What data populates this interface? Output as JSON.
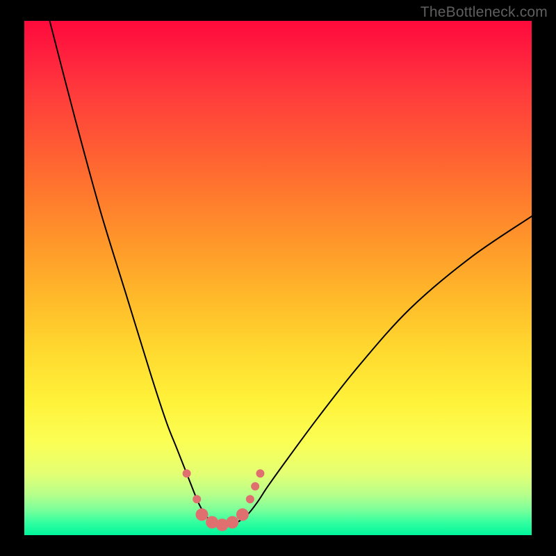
{
  "watermark": "TheBottleneck.com",
  "chart_data": {
    "type": "line",
    "title": "",
    "xlabel": "",
    "ylabel": "",
    "xlim": [
      0,
      100
    ],
    "ylim": [
      0,
      100
    ],
    "grid": false,
    "series": [
      {
        "name": "bottleneck-curve",
        "x": [
          5,
          10,
          15,
          20,
          25,
          28,
          30,
          32,
          34,
          35,
          36,
          37,
          38,
          39,
          40,
          41,
          42,
          44,
          46,
          48,
          52,
          58,
          66,
          76,
          88,
          100
        ],
        "values": [
          100,
          81,
          63,
          47,
          31,
          22,
          17,
          12,
          7,
          5,
          3.5,
          2.5,
          2,
          2,
          2,
          2,
          2.5,
          4,
          6.5,
          9.5,
          15,
          23,
          33,
          44,
          54,
          62
        ],
        "color": "#000000",
        "stroke_width": 2
      }
    ],
    "markers": {
      "name": "highlight-dots",
      "color": "#e07070",
      "radius_small": 6,
      "radius_large": 9,
      "points": [
        {
          "x": 32.0,
          "y": 12.0,
          "r": "small"
        },
        {
          "x": 34.0,
          "y": 7.0,
          "r": "small"
        },
        {
          "x": 35.0,
          "y": 4.0,
          "r": "large"
        },
        {
          "x": 37.0,
          "y": 2.5,
          "r": "large"
        },
        {
          "x": 39.0,
          "y": 2.0,
          "r": "large"
        },
        {
          "x": 41.0,
          "y": 2.5,
          "r": "large"
        },
        {
          "x": 43.0,
          "y": 4.0,
          "r": "large"
        },
        {
          "x": 44.5,
          "y": 7.0,
          "r": "small"
        },
        {
          "x": 45.5,
          "y": 9.5,
          "r": "small"
        },
        {
          "x": 46.5,
          "y": 12.0,
          "r": "small"
        }
      ]
    },
    "gradient_stops": [
      {
        "pos": 0,
        "color": "#ff0a3c"
      },
      {
        "pos": 0.5,
        "color": "#ffba2a"
      },
      {
        "pos": 0.82,
        "color": "#fbff55"
      },
      {
        "pos": 1.0,
        "color": "#00f59a"
      }
    ]
  }
}
